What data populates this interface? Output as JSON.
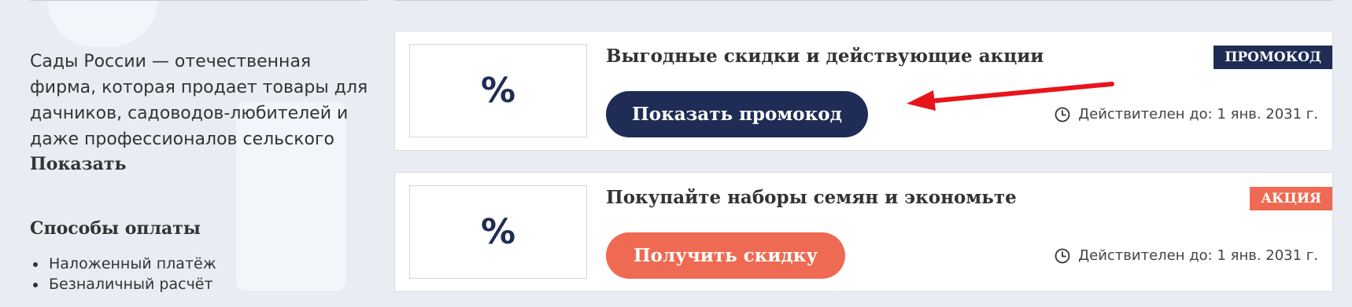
{
  "description": {
    "text": "Сады России — отечественная фирма, которая продает товары для дачников, садоводов-любителей и даже профессионалов сельского хозяйства.",
    "show_more": "Показать"
  },
  "payment": {
    "title": "Способы оплаты",
    "methods": [
      "Наложенный платёж",
      "Безналичный расчёт"
    ]
  },
  "offers": [
    {
      "logo": "%",
      "title": "Выгодные скидки и действующие акции",
      "button": "Показать промокод",
      "badge": "ПРОМОКОД",
      "validity": "Действителен до: 1 янв. 2031 г.",
      "accent": "#1f2c55"
    },
    {
      "logo": "%",
      "title": "Покупайте наборы семян и экономьте",
      "button": "Получить скидку",
      "badge": "АКЦИЯ",
      "validity": "Действителен до: 1 янв. 2031 г.",
      "accent": "#ef6a52"
    }
  ],
  "icons": {
    "validity": "clock-icon"
  },
  "colors": {
    "navy": "#1f2c55",
    "coral": "#ef6a52",
    "arrow": "#e8141c"
  }
}
